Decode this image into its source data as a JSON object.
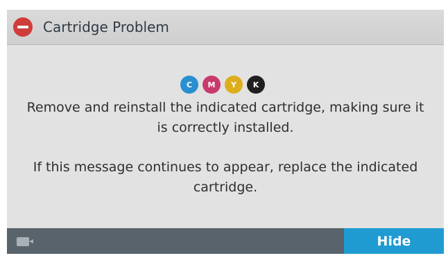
{
  "header": {
    "title": "Cartridge Problem",
    "icon": "stop-icon"
  },
  "cartridges": [
    {
      "label": "C",
      "color": "#2a8fd0"
    },
    {
      "label": "M",
      "color": "#c83a6e"
    },
    {
      "label": "Y",
      "color": "#dcae1c"
    },
    {
      "label": "K",
      "color": "#1f1f1f"
    }
  ],
  "message": {
    "line1": "Remove and reinstall the indicated cartridge, making sure it",
    "line2": "is correctly installed.",
    "line3": "If this message continues to appear, replace the indicated",
    "line4": "cartridge."
  },
  "footer": {
    "hide_label": "Hide",
    "hide_color": "#1f9bd2",
    "left_icon": "video-camera-icon"
  },
  "colors": {
    "header_bg": "#d4d4d4",
    "body_bg": "#e2e2e2",
    "footer_bg": "#59636c",
    "error_red": "#cf3d3a"
  }
}
